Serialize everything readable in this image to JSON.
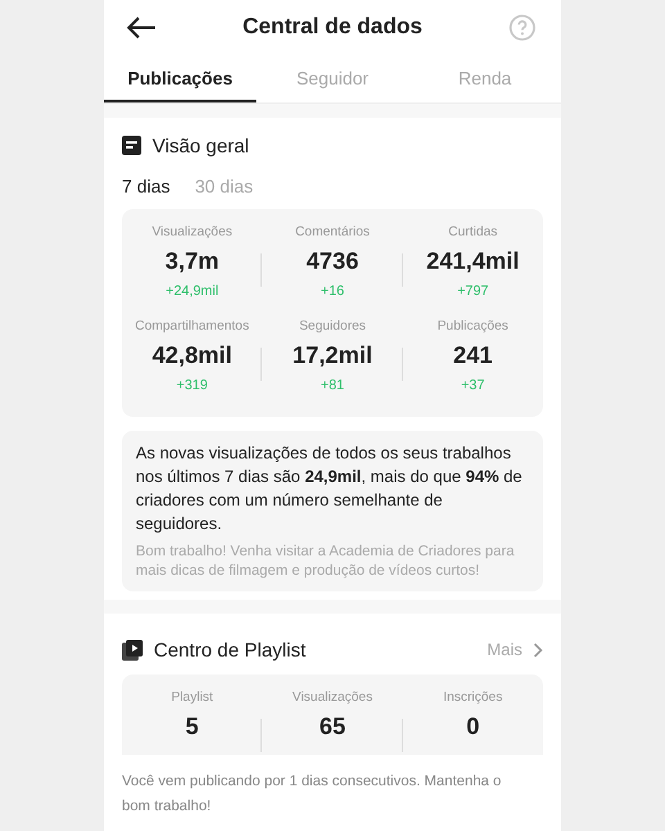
{
  "header": {
    "title": "Central de dados"
  },
  "tabs": [
    {
      "label": "Publicações",
      "selected": true
    },
    {
      "label": "Seguidor",
      "selected": false
    },
    {
      "label": "Renda",
      "selected": false
    }
  ],
  "overview": {
    "title": "Visão geral",
    "periods": [
      {
        "label": "7 dias",
        "selected": true
      },
      {
        "label": "30 dias",
        "selected": false
      }
    ],
    "stats": [
      {
        "label": "Visualizações",
        "value": "3,7m",
        "delta": "+24,9mil"
      },
      {
        "label": "Comentários",
        "value": "4736",
        "delta": "+16"
      },
      {
        "label": "Curtidas",
        "value": "241,4mil",
        "delta": "+797"
      },
      {
        "label": "Compartilhamentos",
        "value": "42,8mil",
        "delta": "+319"
      },
      {
        "label": "Seguidores",
        "value": "17,2mil",
        "delta": "+81"
      },
      {
        "label": "Publicações",
        "value": "241",
        "delta": "+37"
      }
    ],
    "message": "As novas visualizações de todos os seus trabalhos nos últimos 7 dias são **24,9mil**, mais do que **94%** de criadores com um número semelhante de seguidores.",
    "tip": "Bom trabalho! Venha visitar a Academia de Criadores para mais dicas de filmagem e produção de vídeos curtos!"
  },
  "playlist": {
    "title": "Centro de Playlist",
    "more": "Mais",
    "stats": [
      {
        "label": "Playlist",
        "value": "5"
      },
      {
        "label": "Visualizações",
        "value": "65"
      },
      {
        "label": "Inscrições",
        "value": "0"
      }
    ],
    "note": "Você vem publicando por 1 dias consecutivos. Mantenha o bom trabalho!"
  }
}
